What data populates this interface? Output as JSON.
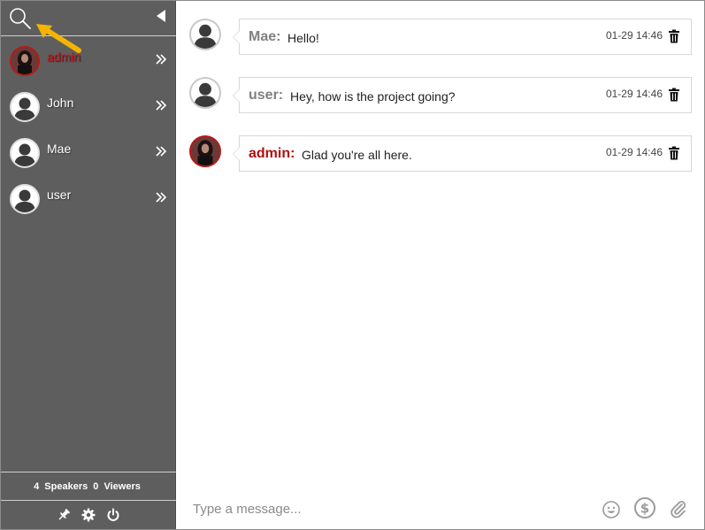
{
  "sidebar": {
    "users": [
      {
        "name": "admin",
        "role": "admin"
      },
      {
        "name": "John",
        "role": "user"
      },
      {
        "name": "Mae",
        "role": "user"
      },
      {
        "name": "user",
        "role": "user"
      }
    ],
    "speakers_count": "4",
    "speakers_label": "Speakers",
    "viewers_count": "0",
    "viewers_label": "Viewers",
    "icons": [
      "search-icon",
      "collapse-arrow-icon",
      "chevron-double-right-icon",
      "pin-icon",
      "gear-icon",
      "power-icon"
    ]
  },
  "messages": [
    {
      "sender": "Mae:",
      "text": "Hello!",
      "time": "01-29 14:46",
      "role": "user"
    },
    {
      "sender": "user:",
      "text": "Hey, how is the project going?",
      "time": "01-29 14:46",
      "role": "user"
    },
    {
      "sender": "admin:",
      "text": "Glad you're all here.",
      "time": "01-29 14:46",
      "role": "admin"
    }
  ],
  "composer": {
    "placeholder": "Type a message...",
    "icons": [
      "emoji-icon",
      "dollar-icon",
      "paperclip-icon"
    ]
  },
  "colors": {
    "sidebar_bg": "#5e5e5e",
    "admin_red": "#b00f0f",
    "annotation_arrow": "#f5b400"
  }
}
